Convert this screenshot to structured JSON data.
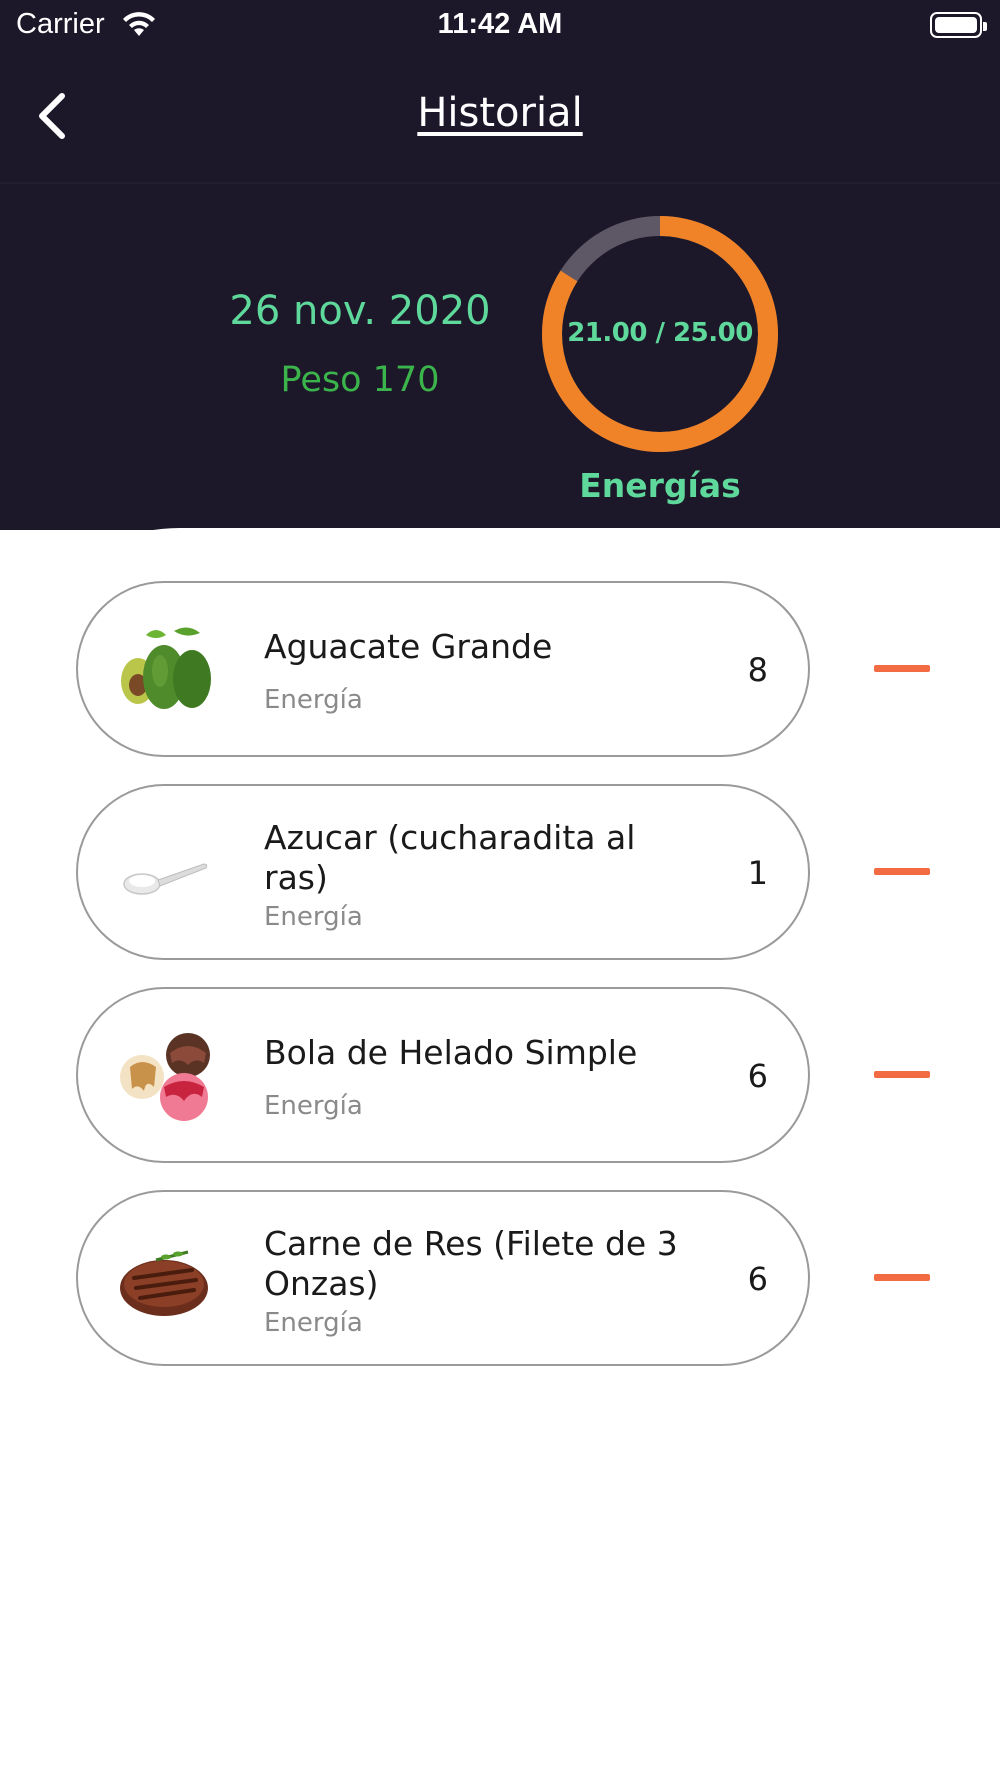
{
  "status_bar": {
    "carrier": "Carrier",
    "time": "11:42 AM"
  },
  "nav": {
    "title": "Historial",
    "back_icon": "chevron-left-icon"
  },
  "summary": {
    "date": "26 nov. 2020",
    "peso": "Peso 170",
    "progress_text": "21.00 / 25.00",
    "progress_current": 21.0,
    "progress_total": 25.0,
    "progress_label": "Energías",
    "progress_color": "#f08327",
    "progress_track_color": "#5e5866"
  },
  "colors": {
    "header_bg": "#1c1729",
    "accent_green": "#5fd99b",
    "peso_green": "#3bb44b",
    "minus_orange": "#f26b43"
  },
  "items": [
    {
      "name": "Aguacate Grande",
      "category": "Energía",
      "quantity": "8",
      "image_icon": "avocado-icon"
    },
    {
      "name": "Azucar (cucharadita al ras)",
      "category": "Energía",
      "quantity": "1",
      "image_icon": "sugar-spoon-icon"
    },
    {
      "name": "Bola de Helado Simple",
      "category": "Energía",
      "quantity": "6",
      "image_icon": "ice-cream-icon"
    },
    {
      "name": "Carne de Res (Filete de 3 Onzas)",
      "category": "Energía",
      "quantity": "6",
      "image_icon": "steak-icon"
    }
  ]
}
